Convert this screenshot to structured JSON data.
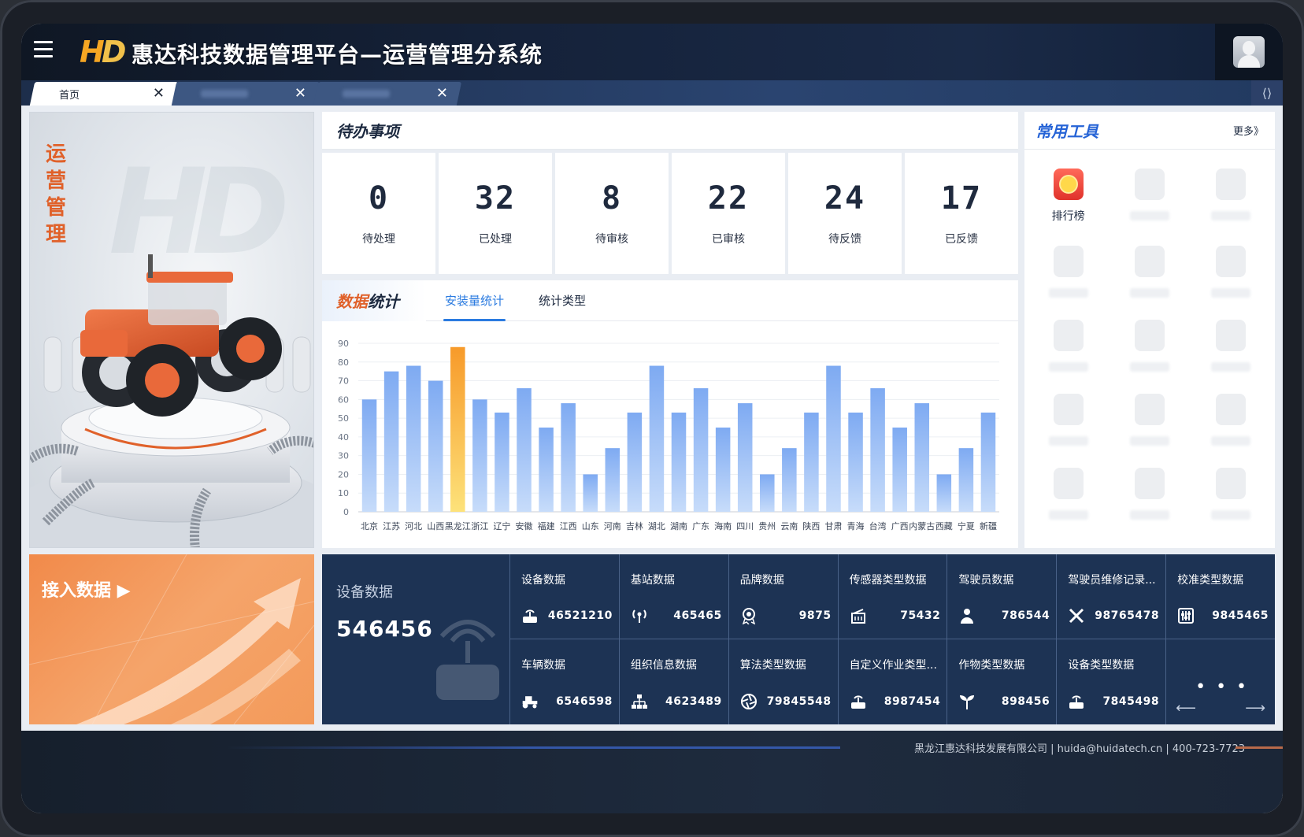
{
  "header": {
    "logo_text": "HD",
    "title": "惠达科技数据管理平台—运营管理分系统"
  },
  "tabs": [
    {
      "label": "首页",
      "active": true
    },
    {
      "label": "",
      "active": false
    },
    {
      "label": "",
      "active": false
    }
  ],
  "hero": {
    "title": "运营管理"
  },
  "todo": {
    "title": "待办事项",
    "items": [
      {
        "value": "0",
        "label": "待处理"
      },
      {
        "value": "32",
        "label": "已处理"
      },
      {
        "value": "8",
        "label": "待审核"
      },
      {
        "value": "22",
        "label": "已审核"
      },
      {
        "value": "24",
        "label": "待反馈"
      },
      {
        "value": "17",
        "label": "已反馈"
      }
    ]
  },
  "stats": {
    "title_a": "数据",
    "title_b": "统计",
    "tabs": [
      "安装量统计",
      "统计类型"
    ],
    "active_tab": 0
  },
  "chart_data": {
    "type": "bar",
    "categories": [
      "北京",
      "江苏",
      "河北",
      "山西",
      "黑龙江",
      "浙江",
      "辽宁",
      "安徽",
      "福建",
      "江西",
      "山东",
      "河南",
      "吉林",
      "湖北",
      "湖南",
      "广东",
      "海南",
      "四川",
      "贵州",
      "云南",
      "陕西",
      "甘肃",
      "青海",
      "台湾",
      "广西",
      "内蒙古",
      "西藏",
      "宁夏",
      "新疆"
    ],
    "values": [
      60,
      75,
      78,
      70,
      88,
      60,
      53,
      66,
      45,
      58,
      20,
      34,
      53,
      78,
      53,
      66,
      45,
      58,
      20,
      34,
      53,
      78,
      53,
      66,
      45,
      58,
      20,
      34,
      53
    ],
    "highlight_index": 4,
    "ylim": [
      0,
      90
    ],
    "yticks": [
      0,
      10,
      20,
      30,
      40,
      50,
      60,
      70,
      80,
      90
    ],
    "grid": true,
    "colors": {
      "bar": "#8ab6f5",
      "highlight": "#f7a93a"
    }
  },
  "tools": {
    "title": "常用工具",
    "more": "更多》",
    "items": [
      {
        "label": "排行榜",
        "icon": "medal-icon",
        "visible": true
      },
      {
        "label": "",
        "visible": false
      },
      {
        "label": "",
        "visible": false
      },
      {
        "label": "",
        "visible": false
      },
      {
        "label": "",
        "visible": false
      },
      {
        "label": "",
        "visible": false
      },
      {
        "label": "",
        "visible": false
      },
      {
        "label": "",
        "visible": false
      },
      {
        "label": "",
        "visible": false
      },
      {
        "label": "",
        "visible": false
      },
      {
        "label": "",
        "visible": false
      },
      {
        "label": "",
        "visible": false
      },
      {
        "label": "",
        "visible": false
      },
      {
        "label": "",
        "visible": false
      },
      {
        "label": "",
        "visible": false
      }
    ]
  },
  "access": {
    "label": "接入数据 ▶"
  },
  "device": {
    "main_label": "设备数据",
    "main_value": "546456",
    "cells": [
      {
        "name": "设备数据",
        "value": "46521210",
        "icon": "router-icon"
      },
      {
        "name": "基站数据",
        "value": "465465",
        "icon": "antenna-icon"
      },
      {
        "name": "品牌数据",
        "value": "9875",
        "icon": "badge-icon"
      },
      {
        "name": "传感器类型数据",
        "value": "75432",
        "icon": "sensor-icon"
      },
      {
        "name": "驾驶员数据",
        "value": "786544",
        "icon": "driver-icon"
      },
      {
        "name": "驾驶员维修记录...",
        "value": "98765478",
        "icon": "tools-icon"
      },
      {
        "name": "校准类型数据",
        "value": "9845465",
        "icon": "sliders-icon"
      },
      {
        "name": "车辆数据",
        "value": "6546598",
        "icon": "tractor-icon"
      },
      {
        "name": "组织信息数据",
        "value": "4623489",
        "icon": "org-icon"
      },
      {
        "name": "算法类型数据",
        "value": "79845548",
        "icon": "aperture-icon"
      },
      {
        "name": "自定义作业类型...",
        "value": "8987454",
        "icon": "router-icon"
      },
      {
        "name": "作物类型数据",
        "value": "898456",
        "icon": "sprout-icon"
      },
      {
        "name": "设备类型数据",
        "value": "7845498",
        "icon": "router-icon"
      }
    ],
    "more_dots": "• • •",
    "prev_arrow": "⟵",
    "next_arrow": "⟶"
  },
  "footer": {
    "text": "黑龙江惠达科技发展有限公司 | huida@huidatech.cn | 400-723-7723"
  }
}
